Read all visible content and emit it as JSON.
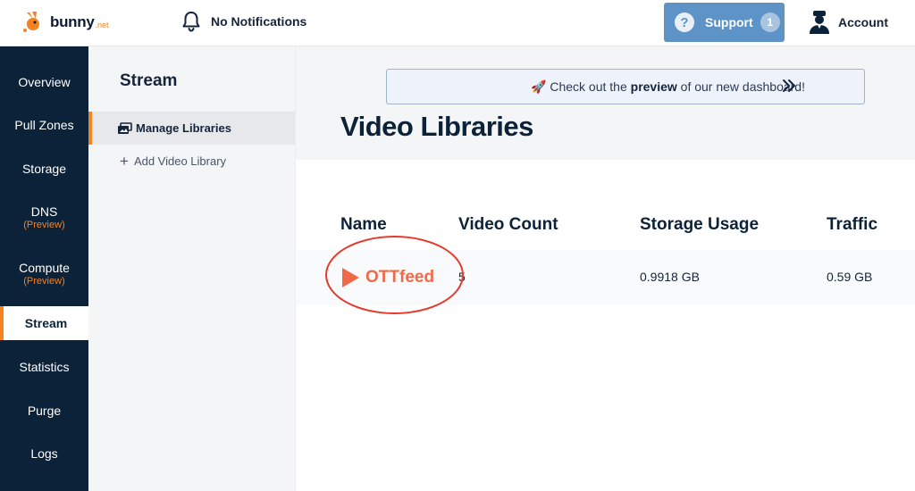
{
  "header": {
    "logo_text": "bunny",
    "logo_suffix": ".net",
    "notifications_label": "No Notifications",
    "support_label": "Support",
    "support_count": "1",
    "support_icon_glyph": "?",
    "account_label": "Account"
  },
  "sidebar": {
    "items": [
      {
        "label": "Overview"
      },
      {
        "label": "Pull Zones"
      },
      {
        "label": "Storage"
      },
      {
        "label": "DNS",
        "sub": "(Preview)"
      },
      {
        "label": "Compute",
        "sub": "(Preview)"
      },
      {
        "label": "Stream",
        "active": true
      },
      {
        "label": "Statistics"
      },
      {
        "label": "Purge"
      },
      {
        "label": "Logs"
      }
    ]
  },
  "subpanel": {
    "title": "Stream",
    "items": [
      {
        "label": "Manage Libraries",
        "active": true,
        "icon": "library-icon"
      },
      {
        "label": "Add Video Library",
        "icon": "plus-icon",
        "glyph": "+"
      }
    ]
  },
  "banner": {
    "emoji": "🚀",
    "text_before": "Check out the ",
    "text_bold": "preview",
    "text_after": " of our new dashboard!"
  },
  "main": {
    "title": "Video Libraries",
    "columns": [
      "Name",
      "Video Count",
      "Storage Usage",
      "Traffic"
    ],
    "rows": [
      {
        "name": "OTTfeed",
        "video_count": "5",
        "storage_usage": "0.9918 GB",
        "traffic": "0.59 GB"
      }
    ]
  },
  "colors": {
    "sidebar_bg": "#0c2238",
    "accent_orange": "#f58220",
    "support_blue": "#5d93c6",
    "link_coral": "#f06a4a",
    "annotation_red": "#e8372b"
  }
}
